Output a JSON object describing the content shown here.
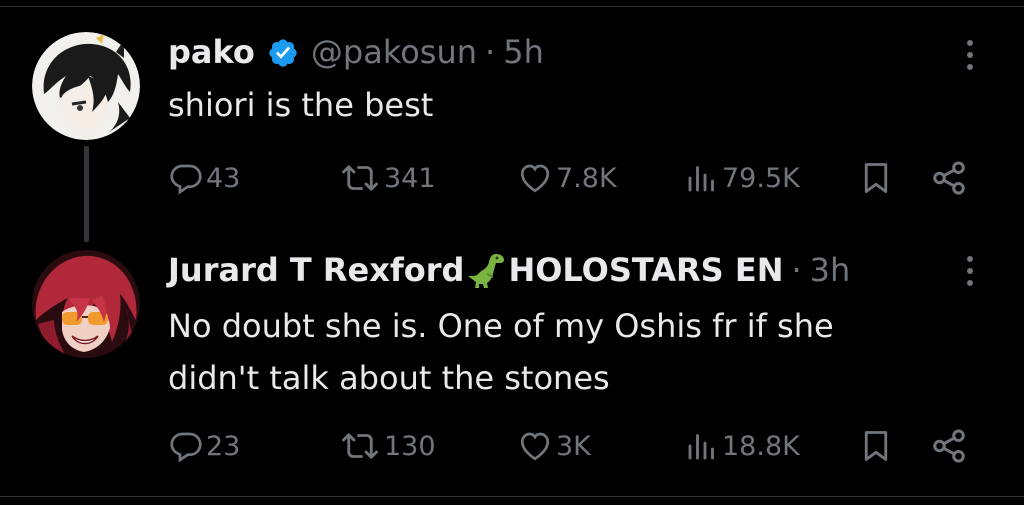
{
  "posts": [
    {
      "display_name": "pako",
      "verified_icon": "verified-badge-icon",
      "handle": "@pakosun",
      "separator": "·",
      "time": "5h",
      "text_lines": [
        "shiori is the best"
      ],
      "stats": {
        "replies": "43",
        "reposts": "341",
        "likes": "7.8K",
        "views": "79.5K"
      }
    },
    {
      "display_name": "Jurard T Rexford",
      "name_emoji": "dinosaur-emoji",
      "display_name_suffix": "HOLOSTARS EN",
      "separator": "·",
      "time": "3h",
      "text_lines": [
        "No doubt she is. One of my Oshis fr if she",
        "didn't talk about the stones"
      ],
      "stats": {
        "replies": "23",
        "reposts": "130",
        "likes": "3K",
        "views": "18.8K"
      }
    }
  ],
  "colors": {
    "background": "#000000",
    "text_primary": "#e7e9ea",
    "text_secondary": "#71767b",
    "verified_blue": "#1d9bf0",
    "thread_line": "#333639"
  },
  "icons": [
    "reply-icon",
    "repost-icon",
    "like-icon",
    "views-icon",
    "bookmark-icon",
    "share-icon",
    "more-options-icon"
  ]
}
